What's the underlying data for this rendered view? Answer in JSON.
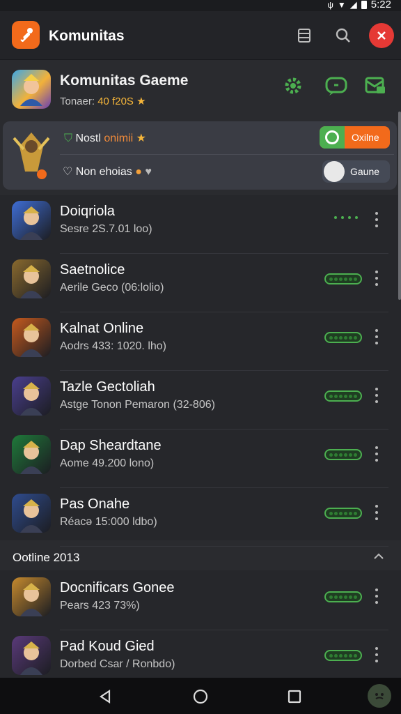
{
  "status": {
    "time": "5:22"
  },
  "appbar": {
    "title": "Komunitas"
  },
  "header": {
    "title": "Komunitas Gaeme",
    "subtitle_label": "Tonaer:",
    "subtitle_value": "40 f20S"
  },
  "featured": {
    "line1_prefix": "Nostl",
    "line1_highlight": "onimii",
    "line2": "Non ehoias",
    "toggle_online_label": "Oxilne",
    "toggle_game_label": "Gaune"
  },
  "list": [
    {
      "title": "Doiqriola",
      "subtitle": "Sesre 2S.7.01 loo)",
      "status": "dots",
      "accent": "#3f6ed6"
    },
    {
      "title": "Saetnolice",
      "subtitle": "Aerile Geco (06:lolio)",
      "status": "badge",
      "accent": "#8a6a2e"
    },
    {
      "title": "Kalnat Online",
      "subtitle": "Aodrs 433: 1020. lho)",
      "status": "badge",
      "accent": "#c65a1e"
    },
    {
      "title": "Tazle Gectoliah",
      "subtitle": "Astge Tonon Pemaron (32-806)",
      "status": "badge",
      "accent": "#4a3f8e"
    },
    {
      "title": "Dap Sheardtane",
      "subtitle": "Aome 49.200 lono)",
      "status": "badge",
      "accent": "#1f7a3a"
    },
    {
      "title": "Pas Onahe",
      "subtitle": "Réacə 15:000 ldbo)",
      "status": "badge",
      "accent": "#2f4c8e"
    }
  ],
  "section": {
    "title": "Ootline 2013"
  },
  "list2": [
    {
      "title": "Docnificars Gonee",
      "subtitle": "Pears 423 73%)",
      "status": "badge",
      "accent": "#c68a2e"
    },
    {
      "title": "Pad Koud Gied",
      "subtitle": "Dorbed Csar / Ronbdo)",
      "status": "badge",
      "accent": "#5a3a7a"
    }
  ],
  "colors": {
    "accent_orange": "#f26a1b",
    "accent_green": "#4caf50",
    "close_red": "#e53935"
  },
  "icons": {
    "app_logo": "wrench-logo-icon",
    "appbar": [
      "tablet-icon",
      "search-icon",
      "close-icon"
    ],
    "header": [
      "gear-icon",
      "chat-icon",
      "message-icon"
    ]
  }
}
